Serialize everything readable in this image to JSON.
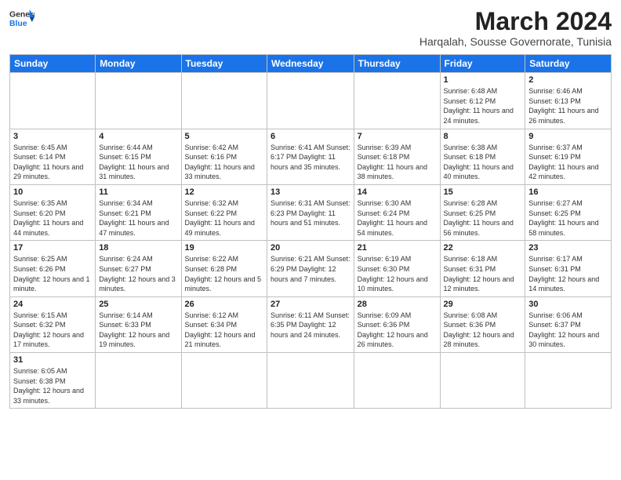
{
  "header": {
    "logo_general": "General",
    "logo_blue": "Blue",
    "title": "March 2024",
    "subtitle": "Harqalah, Sousse Governorate, Tunisia"
  },
  "weekdays": [
    "Sunday",
    "Monday",
    "Tuesday",
    "Wednesday",
    "Thursday",
    "Friday",
    "Saturday"
  ],
  "weeks": [
    [
      {
        "day": "",
        "info": ""
      },
      {
        "day": "",
        "info": ""
      },
      {
        "day": "",
        "info": ""
      },
      {
        "day": "",
        "info": ""
      },
      {
        "day": "",
        "info": ""
      },
      {
        "day": "1",
        "info": "Sunrise: 6:48 AM\nSunset: 6:12 PM\nDaylight: 11 hours\nand 24 minutes."
      },
      {
        "day": "2",
        "info": "Sunrise: 6:46 AM\nSunset: 6:13 PM\nDaylight: 11 hours\nand 26 minutes."
      }
    ],
    [
      {
        "day": "3",
        "info": "Sunrise: 6:45 AM\nSunset: 6:14 PM\nDaylight: 11 hours\nand 29 minutes."
      },
      {
        "day": "4",
        "info": "Sunrise: 6:44 AM\nSunset: 6:15 PM\nDaylight: 11 hours\nand 31 minutes."
      },
      {
        "day": "5",
        "info": "Sunrise: 6:42 AM\nSunset: 6:16 PM\nDaylight: 11 hours\nand 33 minutes."
      },
      {
        "day": "6",
        "info": "Sunrise: 6:41 AM\nSunset: 6:17 PM\nDaylight: 11 hours\nand 35 minutes."
      },
      {
        "day": "7",
        "info": "Sunrise: 6:39 AM\nSunset: 6:18 PM\nDaylight: 11 hours\nand 38 minutes."
      },
      {
        "day": "8",
        "info": "Sunrise: 6:38 AM\nSunset: 6:18 PM\nDaylight: 11 hours\nand 40 minutes."
      },
      {
        "day": "9",
        "info": "Sunrise: 6:37 AM\nSunset: 6:19 PM\nDaylight: 11 hours\nand 42 minutes."
      }
    ],
    [
      {
        "day": "10",
        "info": "Sunrise: 6:35 AM\nSunset: 6:20 PM\nDaylight: 11 hours\nand 44 minutes."
      },
      {
        "day": "11",
        "info": "Sunrise: 6:34 AM\nSunset: 6:21 PM\nDaylight: 11 hours\nand 47 minutes."
      },
      {
        "day": "12",
        "info": "Sunrise: 6:32 AM\nSunset: 6:22 PM\nDaylight: 11 hours\nand 49 minutes."
      },
      {
        "day": "13",
        "info": "Sunrise: 6:31 AM\nSunset: 6:23 PM\nDaylight: 11 hours\nand 51 minutes."
      },
      {
        "day": "14",
        "info": "Sunrise: 6:30 AM\nSunset: 6:24 PM\nDaylight: 11 hours\nand 54 minutes."
      },
      {
        "day": "15",
        "info": "Sunrise: 6:28 AM\nSunset: 6:25 PM\nDaylight: 11 hours\nand 56 minutes."
      },
      {
        "day": "16",
        "info": "Sunrise: 6:27 AM\nSunset: 6:25 PM\nDaylight: 11 hours\nand 58 minutes."
      }
    ],
    [
      {
        "day": "17",
        "info": "Sunrise: 6:25 AM\nSunset: 6:26 PM\nDaylight: 12 hours\nand 1 minute."
      },
      {
        "day": "18",
        "info": "Sunrise: 6:24 AM\nSunset: 6:27 PM\nDaylight: 12 hours\nand 3 minutes."
      },
      {
        "day": "19",
        "info": "Sunrise: 6:22 AM\nSunset: 6:28 PM\nDaylight: 12 hours\nand 5 minutes."
      },
      {
        "day": "20",
        "info": "Sunrise: 6:21 AM\nSunset: 6:29 PM\nDaylight: 12 hours\nand 7 minutes."
      },
      {
        "day": "21",
        "info": "Sunrise: 6:19 AM\nSunset: 6:30 PM\nDaylight: 12 hours\nand 10 minutes."
      },
      {
        "day": "22",
        "info": "Sunrise: 6:18 AM\nSunset: 6:31 PM\nDaylight: 12 hours\nand 12 minutes."
      },
      {
        "day": "23",
        "info": "Sunrise: 6:17 AM\nSunset: 6:31 PM\nDaylight: 12 hours\nand 14 minutes."
      }
    ],
    [
      {
        "day": "24",
        "info": "Sunrise: 6:15 AM\nSunset: 6:32 PM\nDaylight: 12 hours\nand 17 minutes."
      },
      {
        "day": "25",
        "info": "Sunrise: 6:14 AM\nSunset: 6:33 PM\nDaylight: 12 hours\nand 19 minutes."
      },
      {
        "day": "26",
        "info": "Sunrise: 6:12 AM\nSunset: 6:34 PM\nDaylight: 12 hours\nand 21 minutes."
      },
      {
        "day": "27",
        "info": "Sunrise: 6:11 AM\nSunset: 6:35 PM\nDaylight: 12 hours\nand 24 minutes."
      },
      {
        "day": "28",
        "info": "Sunrise: 6:09 AM\nSunset: 6:36 PM\nDaylight: 12 hours\nand 26 minutes."
      },
      {
        "day": "29",
        "info": "Sunrise: 6:08 AM\nSunset: 6:36 PM\nDaylight: 12 hours\nand 28 minutes."
      },
      {
        "day": "30",
        "info": "Sunrise: 6:06 AM\nSunset: 6:37 PM\nDaylight: 12 hours\nand 30 minutes."
      }
    ],
    [
      {
        "day": "31",
        "info": "Sunrise: 6:05 AM\nSunset: 6:38 PM\nDaylight: 12 hours\nand 33 minutes."
      },
      {
        "day": "",
        "info": ""
      },
      {
        "day": "",
        "info": ""
      },
      {
        "day": "",
        "info": ""
      },
      {
        "day": "",
        "info": ""
      },
      {
        "day": "",
        "info": ""
      },
      {
        "day": "",
        "info": ""
      }
    ]
  ]
}
